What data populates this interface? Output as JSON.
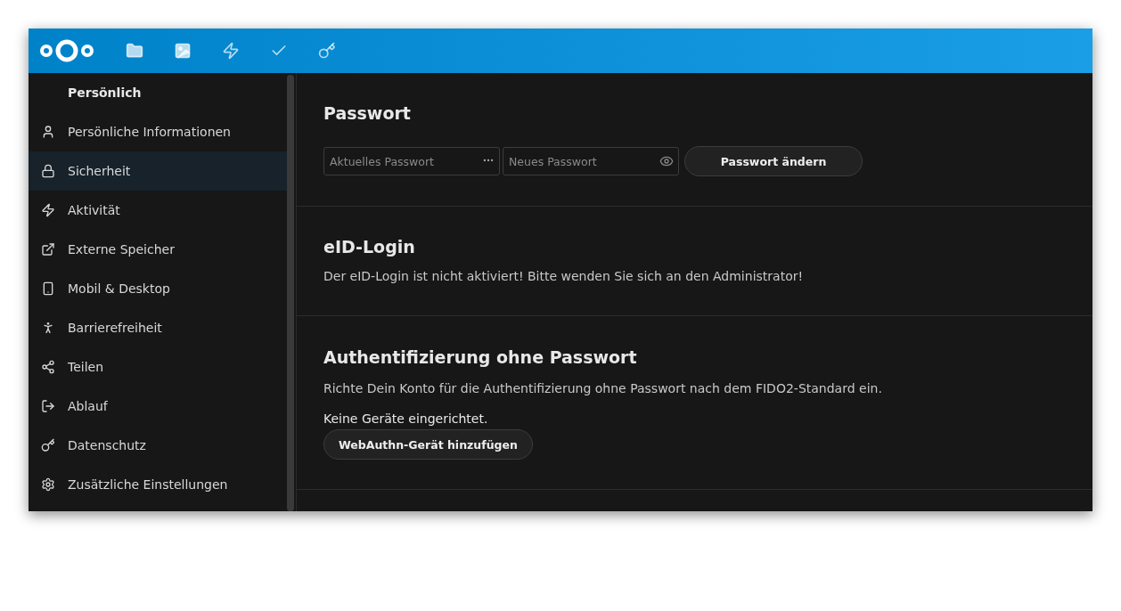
{
  "header": {
    "apps": [
      {
        "selected": false
      },
      {
        "selected": false
      },
      {
        "selected": false
      },
      {
        "selected": false
      },
      {
        "selected": false
      }
    ]
  },
  "sidebar": {
    "heading": "Persönlich",
    "items": [
      {
        "label": "Persönliche Informationen",
        "selected": false
      },
      {
        "label": "Sicherheit",
        "selected": true
      },
      {
        "label": "Aktivität",
        "selected": false
      },
      {
        "label": "Externe Speicher",
        "selected": false
      },
      {
        "label": "Mobil & Desktop",
        "selected": false
      },
      {
        "label": "Barrierefreiheit",
        "selected": false
      },
      {
        "label": "Teilen",
        "selected": false
      },
      {
        "label": "Ablauf",
        "selected": false
      },
      {
        "label": "Datenschutz",
        "selected": false
      },
      {
        "label": "Zusätzliche Einstellungen",
        "selected": false
      }
    ]
  },
  "password": {
    "title": "Passwort",
    "current": {
      "placeholder": "Aktuelles Passwort"
    },
    "new": {
      "placeholder": "Neues Passwort"
    },
    "button": "Passwort ändern"
  },
  "eid_login": {
    "title": "eID-Login",
    "text": "Der eID-Login ist nicht aktiviert! Bitte wenden Sie sich an den Administrator!"
  },
  "passwordless": {
    "title": "Authentifizierung ohne Passwort",
    "text": "Richte Dein Konto für die Authentifizierung ohne Passwort nach dem FIDO2-Standard ein.",
    "status": "Keine Geräte eingerichtet.",
    "button": "WebAuthn-Gerät hinzufügen"
  }
}
